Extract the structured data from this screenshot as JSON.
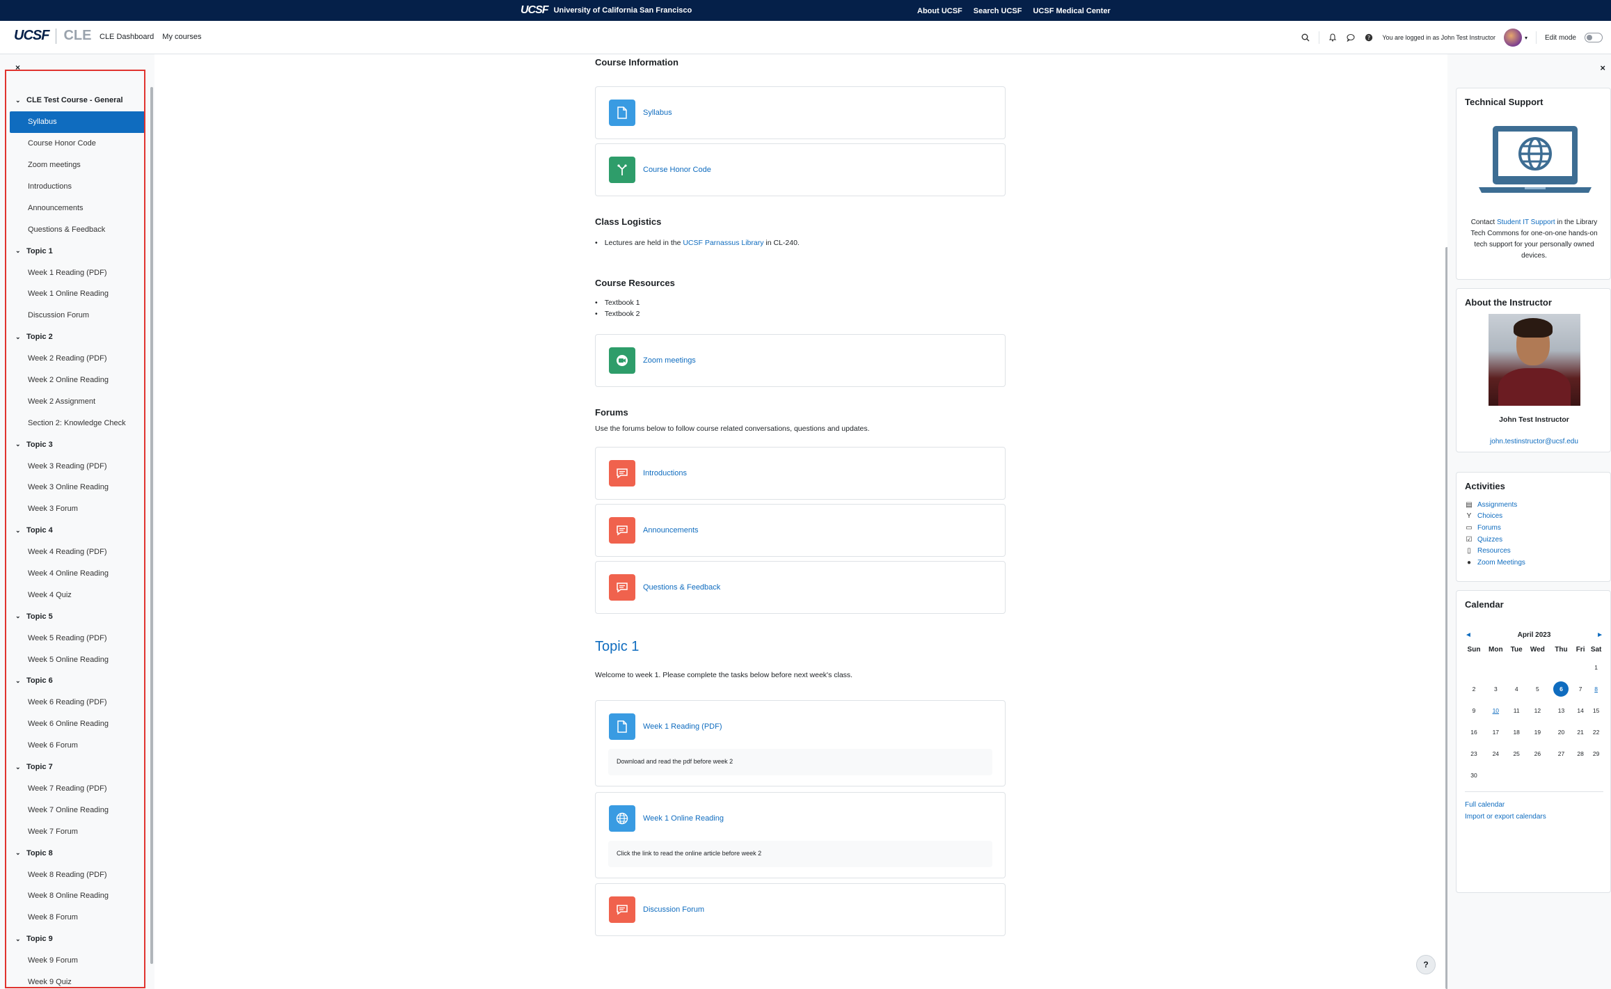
{
  "top_bar": {
    "logo": "UCSF",
    "brand": "University of California San Francisco",
    "links": [
      "About UCSF",
      "Search UCSF",
      "UCSF Medical Center"
    ]
  },
  "navbar": {
    "logo": "UCSF",
    "app_name": "CLE",
    "links": [
      "CLE Dashboard",
      "My courses"
    ],
    "logged_in_text": "You are logged in as John Test Instructor",
    "edit_mode_label": "Edit mode"
  },
  "course_index": {
    "rows": [
      {
        "type": "section",
        "label": "CLE Test Course - General"
      },
      {
        "type": "item",
        "label": "Syllabus",
        "active": true
      },
      {
        "type": "item",
        "label": "Course Honor Code"
      },
      {
        "type": "item",
        "label": "Zoom meetings"
      },
      {
        "type": "item",
        "label": "Introductions"
      },
      {
        "type": "item",
        "label": "Announcements"
      },
      {
        "type": "item",
        "label": "Questions & Feedback"
      },
      {
        "type": "section",
        "label": "Topic 1"
      },
      {
        "type": "item",
        "label": "Week 1 Reading (PDF)"
      },
      {
        "type": "item",
        "label": "Week 1 Online Reading"
      },
      {
        "type": "item",
        "label": "Discussion Forum"
      },
      {
        "type": "section",
        "label": "Topic 2"
      },
      {
        "type": "item",
        "label": "Week 2 Reading (PDF)"
      },
      {
        "type": "item",
        "label": "Week 2 Online Reading"
      },
      {
        "type": "item",
        "label": "Week 2 Assignment"
      },
      {
        "type": "item",
        "label": "Section 2: Knowledge Check"
      },
      {
        "type": "section",
        "label": "Topic 3"
      },
      {
        "type": "item",
        "label": "Week 3 Reading (PDF)"
      },
      {
        "type": "item",
        "label": "Week 3 Online Reading"
      },
      {
        "type": "item",
        "label": "Week 3 Forum"
      },
      {
        "type": "section",
        "label": "Topic 4"
      },
      {
        "type": "item",
        "label": "Week 4 Reading (PDF)"
      },
      {
        "type": "item",
        "label": "Week 4 Online Reading"
      },
      {
        "type": "item",
        "label": "Week 4 Quiz"
      },
      {
        "type": "section",
        "label": "Topic 5"
      },
      {
        "type": "item",
        "label": "Week 5 Reading (PDF)"
      },
      {
        "type": "item",
        "label": "Week 5 Online Reading"
      },
      {
        "type": "section",
        "label": "Topic 6"
      },
      {
        "type": "item",
        "label": "Week 6 Reading (PDF)"
      },
      {
        "type": "item",
        "label": "Week 6 Online Reading"
      },
      {
        "type": "item",
        "label": "Week 6 Forum"
      },
      {
        "type": "section",
        "label": "Topic 7"
      },
      {
        "type": "item",
        "label": "Week 7 Reading (PDF)"
      },
      {
        "type": "item",
        "label": "Week 7 Online Reading"
      },
      {
        "type": "item",
        "label": "Week 7 Forum"
      },
      {
        "type": "section",
        "label": "Topic 8"
      },
      {
        "type": "item",
        "label": "Week 8 Reading (PDF)"
      },
      {
        "type": "item",
        "label": "Week 8 Online Reading"
      },
      {
        "type": "item",
        "label": "Week 8 Forum"
      },
      {
        "type": "section",
        "label": "Topic 9"
      },
      {
        "type": "item",
        "label": "Week 9 Forum"
      },
      {
        "type": "item",
        "label": "Week 9 Quiz"
      }
    ]
  },
  "main": {
    "course_info_heading": "Course Information",
    "syllabus": "Syllabus",
    "honor_code": "Course Honor Code",
    "logistics_heading": "Class Logistics",
    "logistics_pre": "Lectures are held in the ",
    "logistics_link": "UCSF Parnassus Library",
    "logistics_post": " in CL-240.",
    "resources_heading": "Course Resources",
    "textbook1": "Textbook 1",
    "textbook2": "Textbook 2",
    "zoom": "Zoom meetings",
    "forums_heading": "Forums",
    "forums_desc": "Use the forums below to follow course related conversations, questions and updates.",
    "introductions": "Introductions",
    "announcements": "Announcements",
    "questions": "Questions & Feedback",
    "topic1_title": "Topic 1",
    "topic1_desc": "Welcome to week 1. Please complete the tasks below before next week's class.",
    "week1_pdf": "Week 1 Reading (PDF)",
    "week1_pdf_desc": "Download and read the pdf before week 2",
    "week1_online": "Week 1 Online Reading",
    "week1_online_desc": "Click the link to read the online article before week 2",
    "discussion": "Discussion Forum"
  },
  "blocks": {
    "tech_title": "Technical Support",
    "tech_pre": "Contact ",
    "tech_link": "Student IT Support",
    "tech_post": " in the Library Tech Commons for one-on-one hands-on tech support for your personally owned devices.",
    "instructor_title": "About the Instructor",
    "instructor_name": "John Test Instructor",
    "instructor_email": "john.testinstructor@ucsf.edu",
    "activities_title": "Activities",
    "activities": [
      "Assignments",
      "Choices",
      "Forums",
      "Quizzes",
      "Resources",
      "Zoom Meetings"
    ],
    "calendar_title": "Calendar",
    "calendar_month": "April 2023",
    "calendar_prev": "◄",
    "calendar_next": "►",
    "weekdays": [
      "Sun",
      "Mon",
      "Tue",
      "Wed",
      "Thu",
      "Fri",
      "Sat"
    ],
    "weeks": [
      [
        "",
        "",
        "",
        "",
        "",
        "",
        "1"
      ],
      [
        "2",
        "3",
        "4",
        "5",
        "6",
        "7",
        "8"
      ],
      [
        "9",
        "10",
        "11",
        "12",
        "13",
        "14",
        "15"
      ],
      [
        "16",
        "17",
        "18",
        "19",
        "20",
        "21",
        "22"
      ],
      [
        "23",
        "24",
        "25",
        "26",
        "27",
        "28",
        "29"
      ],
      [
        "30",
        "",
        "",
        "",
        "",
        "",
        ""
      ]
    ],
    "today": "6",
    "event_days": [
      "8",
      "10"
    ],
    "full_calendar": "Full calendar",
    "import_export": "Import or export calendars"
  },
  "help_label": "?"
}
